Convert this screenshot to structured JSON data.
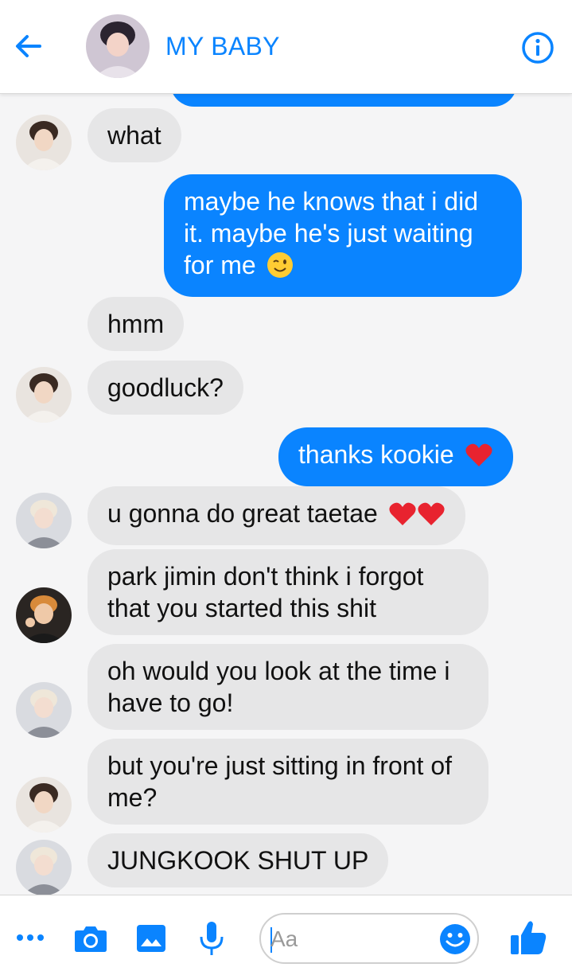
{
  "header": {
    "title": "MY BABY",
    "back_icon": "back-arrow-icon",
    "info_icon": "info-icon"
  },
  "colors": {
    "accent": "#0a84ff",
    "incoming_bubble": "#e6e6e7",
    "background": "#f5f5f6"
  },
  "messages": [
    {
      "direction": "in",
      "text": "what",
      "sender_avatar": "avatar-tae"
    },
    {
      "direction": "out",
      "text": "maybe he knows that i did it. maybe he's just waiting for me",
      "emoji": "winking-face"
    },
    {
      "direction": "in",
      "text": "hmm"
    },
    {
      "direction": "in",
      "text": "goodluck?",
      "sender_avatar": "avatar-tae"
    },
    {
      "direction": "out",
      "text": "thanks kookie",
      "emoji": "red-heart"
    },
    {
      "direction": "in",
      "text": "u gonna do great taetae",
      "emoji": "two-red-hearts",
      "sender_avatar": "avatar-jimin"
    },
    {
      "direction": "in",
      "text": "park jimin don't think i forgot that you started this shit",
      "sender_avatar": "avatar-jungkook"
    },
    {
      "direction": "in",
      "text": "oh would you look at the time i have to go!",
      "sender_avatar": "avatar-jimin"
    },
    {
      "direction": "in",
      "text": "but you're just sitting in front of me?",
      "sender_avatar": "avatar-tae"
    },
    {
      "direction": "in",
      "text": "JUNGKOOK SHUT UP",
      "sender_avatar": "avatar-jimin"
    }
  ],
  "composer": {
    "placeholder": "Aa",
    "icons": [
      "more-icon",
      "camera-icon",
      "gallery-icon",
      "microphone-icon",
      "emoji-icon",
      "thumbs-up-icon"
    ]
  }
}
